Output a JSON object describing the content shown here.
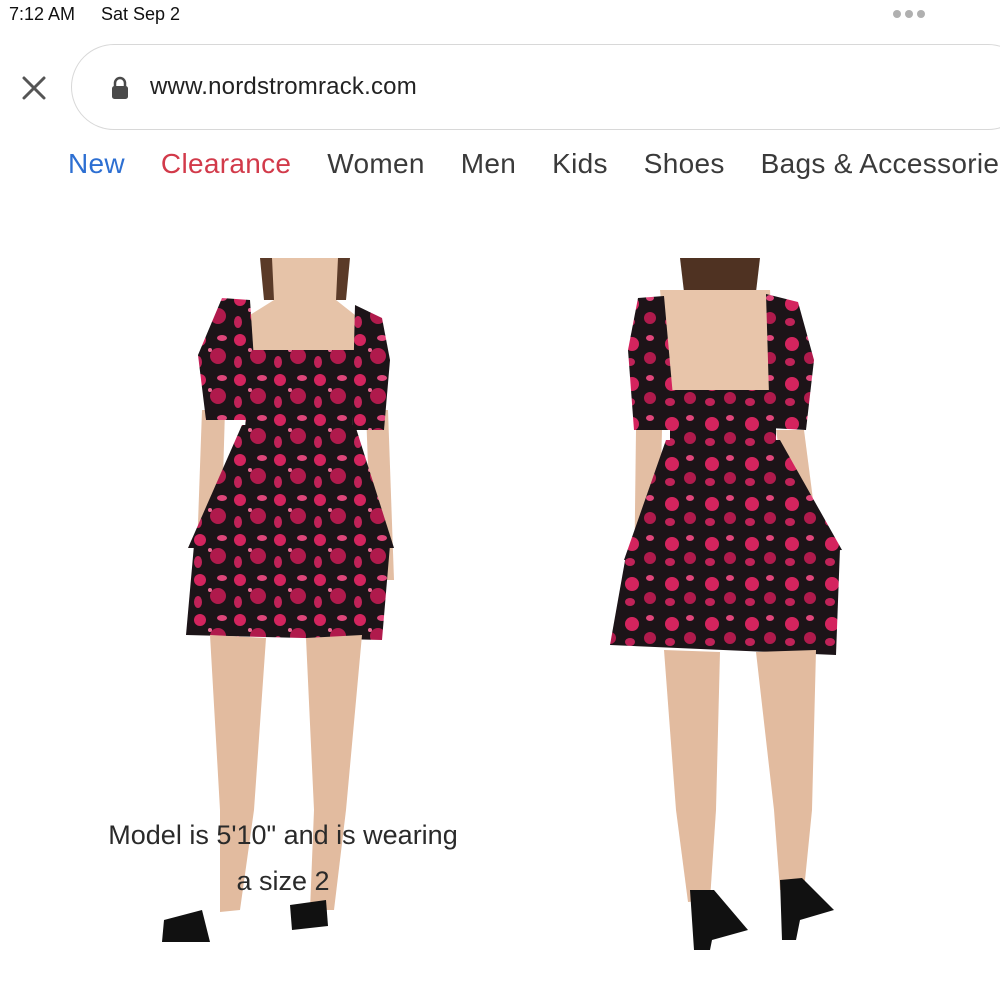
{
  "status_bar": {
    "time": "7:12 AM",
    "date": "Sat Sep 2"
  },
  "browser": {
    "url": "www.nordstromrack.com",
    "icons": {
      "close": "close-icon",
      "lock": "lock-icon",
      "more": "more-dots-icon"
    }
  },
  "nav": {
    "items": [
      {
        "label": "New",
        "color": "#2d6fd2"
      },
      {
        "label": "Clearance",
        "color": "#d23a4a"
      },
      {
        "label": "Women"
      },
      {
        "label": "Men"
      },
      {
        "label": "Kids"
      },
      {
        "label": "Shoes"
      },
      {
        "label": "Bags & Accessories"
      }
    ]
  },
  "product": {
    "caption_line1": "Model is 5'10\" and is wearing",
    "caption_line2": "a size 2",
    "dress_colors": {
      "base": "#1c1418",
      "print": "#d4245e"
    }
  }
}
